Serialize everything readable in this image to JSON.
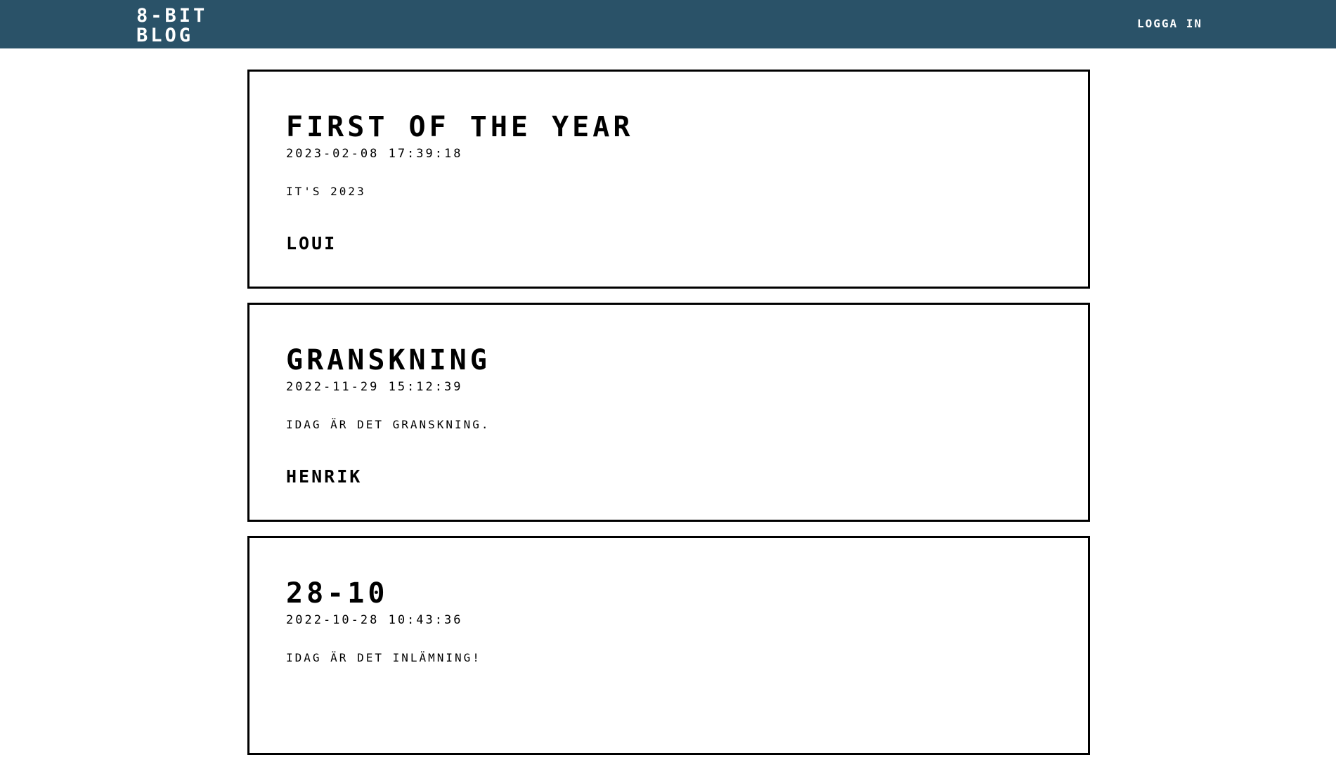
{
  "header": {
    "logo_line1": "8-BIT",
    "logo_line2": "BLOG",
    "login_label": "LOGGA IN"
  },
  "posts": [
    {
      "title": "FIRST OF THE YEAR",
      "date": "2023-02-08 17:39:18",
      "body": "IT'S 2023",
      "author": "LOUI"
    },
    {
      "title": "GRANSKNING",
      "date": "2022-11-29 15:12:39",
      "body": "IDAG ÄR DET GRANSKNING.",
      "author": "HENRIK"
    },
    {
      "title": "28-10",
      "date": "2022-10-28 10:43:36",
      "body": "IDAG ÄR DET INLÄMNING!",
      "author": ""
    }
  ],
  "colors": {
    "header_bg": "#2a5268",
    "header_text": "#ffffff",
    "post_border": "#000000"
  }
}
